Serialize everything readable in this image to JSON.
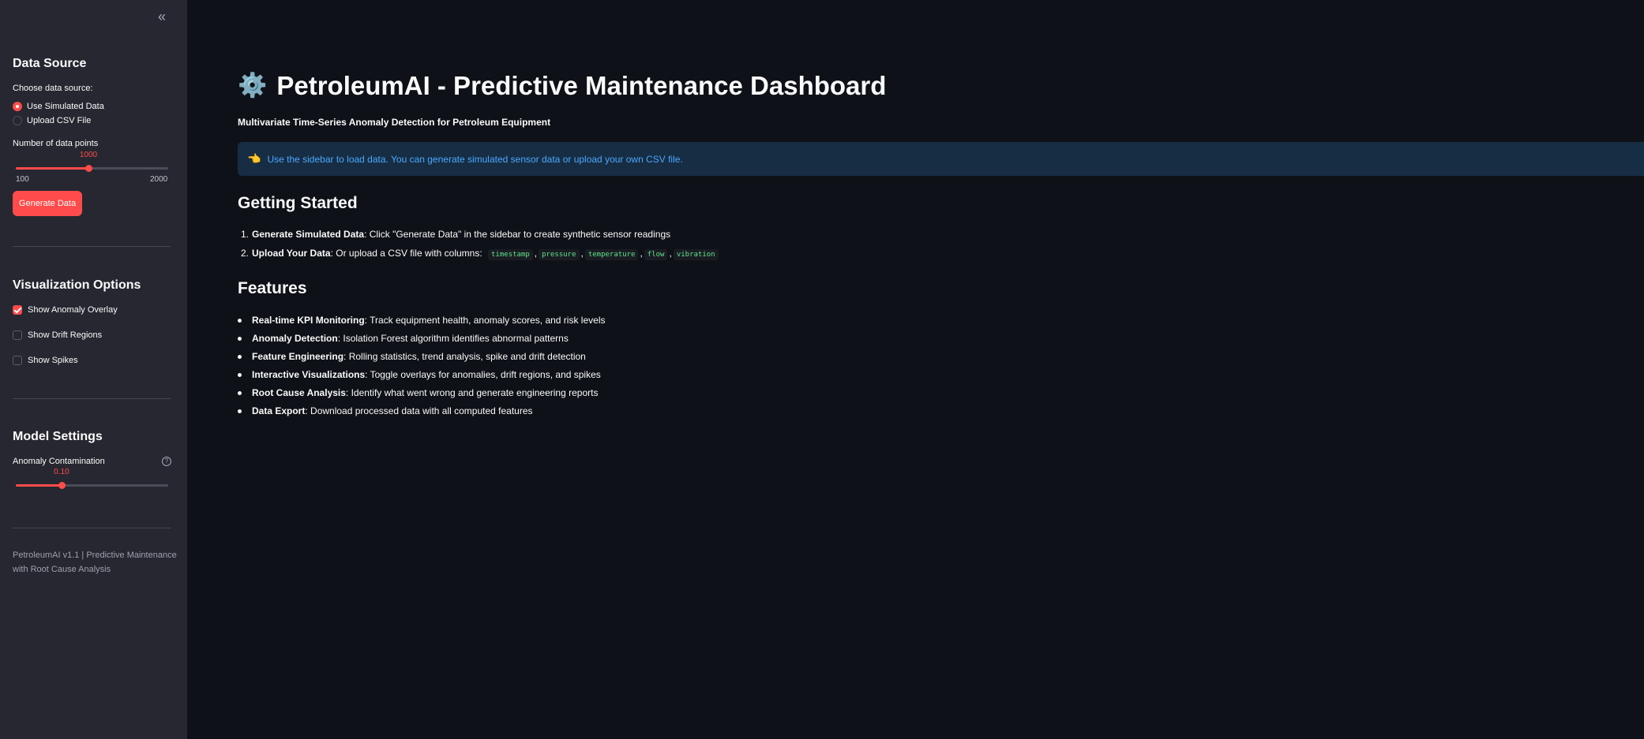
{
  "sidebar": {
    "collapse_icon": "double-chevron-left-icon",
    "collapse_glyph": "«",
    "data_source": {
      "title": "Data Source",
      "choose_label": "Choose data source:",
      "options": [
        {
          "label": "Use Simulated Data",
          "selected": true
        },
        {
          "label": "Upload CSV File",
          "selected": false
        }
      ],
      "points_label": "Number of data points",
      "points_value": "1000",
      "points_min": "100",
      "points_max": "2000",
      "generate_button": "Generate Data"
    },
    "visualization": {
      "title": "Visualization Options",
      "options": [
        {
          "label": "Show Anomaly Overlay",
          "checked": true
        },
        {
          "label": "Show Drift Regions",
          "checked": false
        },
        {
          "label": "Show Spikes",
          "checked": false
        }
      ]
    },
    "model": {
      "title": "Model Settings",
      "contamination_label": "Anomaly Contamination",
      "contamination_value": "0.10",
      "contamination_fraction": 0.3,
      "help_glyph": "?"
    },
    "footer": "PetroleumAI v1.1 | Predictive Maintenance with Root Cause Analysis"
  },
  "main": {
    "title_icon": "gear-icon",
    "title_glyph": "⚙️",
    "title": "PetroleumAI - Predictive Maintenance Dashboard",
    "subtitle": "Multivariate Time-Series Anomaly Detection for Petroleum Equipment",
    "info": {
      "icon": "pointing-hand-icon",
      "glyph": "👈",
      "text": "Use the sidebar to load data. You can generate simulated sensor data or upload your own CSV file."
    },
    "getting_started": {
      "title": "Getting Started",
      "steps": [
        {
          "num": "1.",
          "bold": "Generate Simulated Data",
          "text": ": Click \"Generate Data\" in the sidebar to create synthetic sensor readings"
        },
        {
          "num": "2.",
          "bold": "Upload Your Data",
          "text": ": Or upload a CSV file with columns:"
        }
      ],
      "columns": [
        "timestamp",
        "pressure",
        "temperature",
        "flow",
        "vibration"
      ],
      "column_separator": ","
    },
    "features": {
      "title": "Features",
      "items": [
        {
          "bold": "Real-time KPI Monitoring",
          "text": ": Track equipment health, anomaly scores, and risk levels"
        },
        {
          "bold": "Anomaly Detection",
          "text": ": Isolation Forest algorithm identifies abnormal patterns"
        },
        {
          "bold": "Feature Engineering",
          "text": ": Rolling statistics, trend analysis, spike and drift detection"
        },
        {
          "bold": "Interactive Visualizations",
          "text": ": Toggle overlays for anomalies, drift regions, and spikes"
        },
        {
          "bold": "Root Cause Analysis",
          "text": ": Identify what went wrong and generate engineering reports"
        },
        {
          "bold": "Data Export",
          "text": ": Download processed data with all computed features"
        }
      ]
    }
  }
}
